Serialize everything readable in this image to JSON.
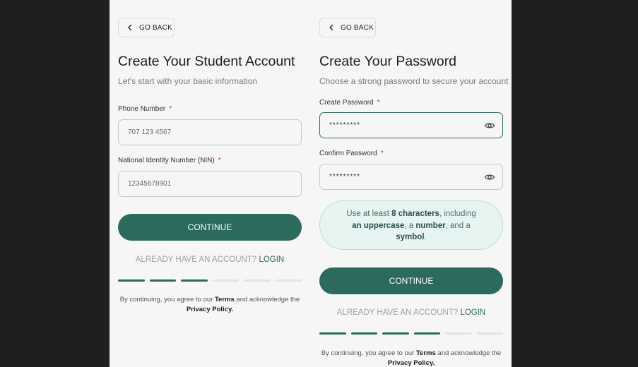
{
  "left": {
    "back_label": "GO BACK",
    "title": "Create Your Student Account",
    "subtitle": "Let's start with your basic information",
    "phone": {
      "label": "Phone Number",
      "required": "*",
      "placeholder": "707 123 4567"
    },
    "nin": {
      "label": "National Identity Number (NIN)",
      "required": "*",
      "placeholder": "12345678901"
    },
    "continue_label": "CONTINUE",
    "login_prompt": "ALREADY HAVE AN ACCOUNT?",
    "login_link": "LOGIN",
    "progress": {
      "total": 6,
      "completed": 3
    },
    "legal": {
      "prefix": "By continuing, you agree to our",
      "terms": "Terms",
      "middle": "and acknowledge the",
      "privacy": "Privacy Policy."
    }
  },
  "right": {
    "back_label": "GO BACK",
    "title": "Create Your Password",
    "subtitle": "Choose a strong password to secure your account",
    "create_password": {
      "label": "Create Password",
      "required": "*",
      "value": "*********"
    },
    "confirm_password": {
      "label": "Confirm Password",
      "required": "*",
      "value": "*********"
    },
    "hint": {
      "part1": "Use at least",
      "bold1": "8 characters",
      "part2": ", including",
      "bold2": "an uppercase",
      "part3": ", a",
      "bold3": "number",
      "part4": ", and a",
      "bold4": "symbol",
      "part5": "."
    },
    "continue_label": "CONTINUE",
    "login_prompt": "ALREADY HAVE AN ACCOUNT?",
    "login_link": "LOGIN",
    "progress": {
      "total": 6,
      "completed": 4
    },
    "legal": {
      "prefix": "By continuing, you agree to our",
      "terms": "Terms",
      "middle": "and acknowledge the",
      "privacy": "Privacy Policy."
    }
  },
  "colors": {
    "accent": "#2c6a5e",
    "panel_bg": "#f6f6f6",
    "page_bg": "#1f1f1f",
    "required": "#c0392b",
    "hint_bg": "#e7f5f2"
  }
}
